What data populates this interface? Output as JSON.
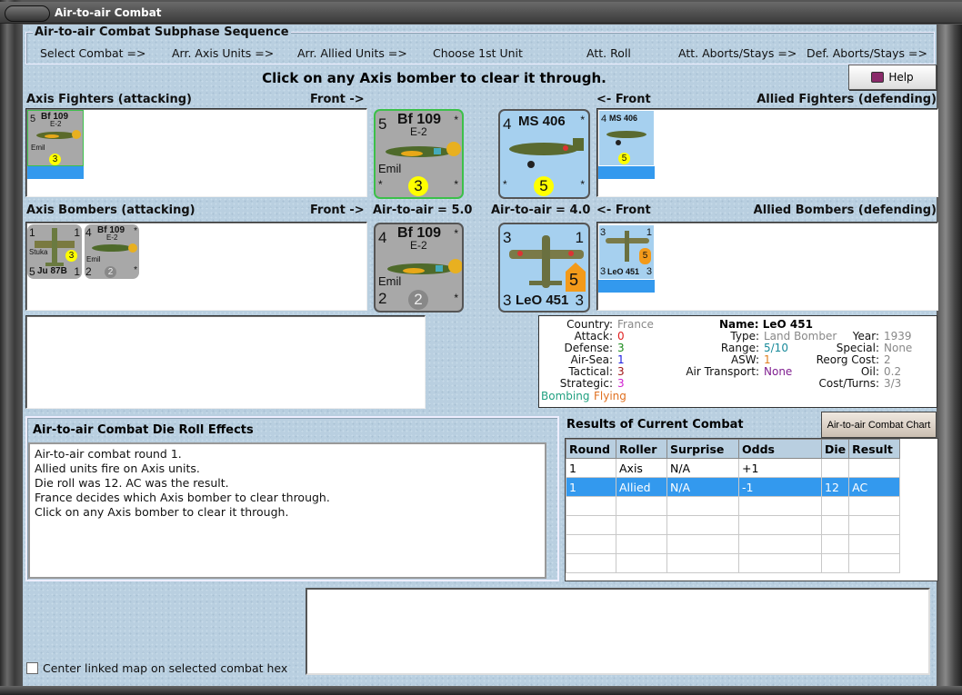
{
  "window": {
    "title": "Air-to-air Combat"
  },
  "sequence": {
    "title": "Air-to-air Combat Subphase Sequence",
    "steps": [
      "Select Combat =>",
      "Arr. Axis Units =>",
      "Arr. Allied Units =>",
      "Choose 1st Unit",
      "Att. Roll",
      "Att. Aborts/Stays =>",
      "Def. Aborts/Stays =>"
    ]
  },
  "instruction": "Click on any Axis bomber to clear it through.",
  "help_label": "Help",
  "labels": {
    "axis_fighters": "Axis Fighters (attacking)",
    "front_right": "Front ->",
    "front_left": "<- Front",
    "allied_fighters": "Allied Fighters (defending)",
    "axis_bombers": "Axis Bombers (attacking)",
    "allied_bombers": "Allied Bombers (defending)",
    "axis_a2a": "Air-to-air = 5.0",
    "allied_a2a": "Air-to-air = 4.0"
  },
  "counters": {
    "axis_fighter": {
      "tl": "5",
      "name": "Bf 109",
      "sub": "E-2",
      "nick": "Emil",
      "bl": "*",
      "tr": "*",
      "br": "*",
      "disc": "3"
    },
    "axis_bomber_stuka": {
      "tl": "1",
      "tr": "1",
      "nick": "Stuka",
      "bl": "5",
      "name": "Ju 87B",
      "br": "1",
      "disc": "3"
    },
    "axis_bomber_bf": {
      "tl": "4",
      "name": "Bf 109",
      "sub": "E-2",
      "nick": "Emil",
      "bl": "2",
      "tr": "*",
      "br": "*",
      "disc": "2"
    },
    "allied_fighter": {
      "tl": "4",
      "name": "MS 406",
      "bl": "*",
      "tr": "*",
      "br": "*",
      "disc": "5"
    },
    "allied_bomber": {
      "tl": "3",
      "tr": "1",
      "bl": "3",
      "name": "LeO 451",
      "br": "3",
      "disc": "5"
    }
  },
  "colors": {
    "axis_counter": "#a8a8a8",
    "allied_counter": "#a6d0ef",
    "selected_row": "#3399ee",
    "selected_border": "#3cc04a"
  },
  "info": {
    "country_k": "Country:",
    "country": "France",
    "attack_k": "Attack:",
    "attack": "0",
    "defense_k": "Defense:",
    "defense": "3",
    "airsea_k": "Air-Sea:",
    "airsea": "1",
    "tactical_k": "Tactical:",
    "tactical": "3",
    "strategic_k": "Strategic:",
    "strategic": "3",
    "bombing": "Bombing",
    "flying": "Flying",
    "name": "Name: LeO 451",
    "type_k": "Type:",
    "type": "Land Bomber",
    "range_k": "Range:",
    "range": "5/10",
    "asw_k": "ASW:",
    "asw": "1",
    "transport_k": "Air Transport:",
    "transport": "None",
    "year_k": "Year:",
    "year": "1939",
    "special_k": "Special:",
    "special": "None",
    "reorg_k": "Reorg Cost:",
    "reorg": "2",
    "oil_k": "Oil:",
    "oil": "0.2",
    "cost_k": "Cost/Turns:",
    "cost": "3/3"
  },
  "die_panel": {
    "title": "Air-to-air Combat Die Roll Effects",
    "lines": [
      "Air-to-air combat round 1.",
      "Allied units fire on Axis units.",
      "Die roll was 12.  AC was the result.",
      "France decides which Axis bomber to clear through.",
      "Click on any Axis bomber to clear it through."
    ]
  },
  "results": {
    "title": "Results of Current Combat",
    "chart_button": "Air-to-air Combat Chart",
    "columns": [
      "Round",
      "Roller",
      "Surprise",
      "Odds",
      "Die",
      "Result"
    ],
    "rows": [
      [
        "1",
        "Axis",
        "N/A",
        "+1",
        "",
        ""
      ],
      [
        "1",
        "Allied",
        "N/A",
        "-1",
        "12",
        "AC"
      ]
    ],
    "selected_row": 1
  },
  "center_map": {
    "label": "Center linked map on selected combat hex",
    "checked": false
  }
}
